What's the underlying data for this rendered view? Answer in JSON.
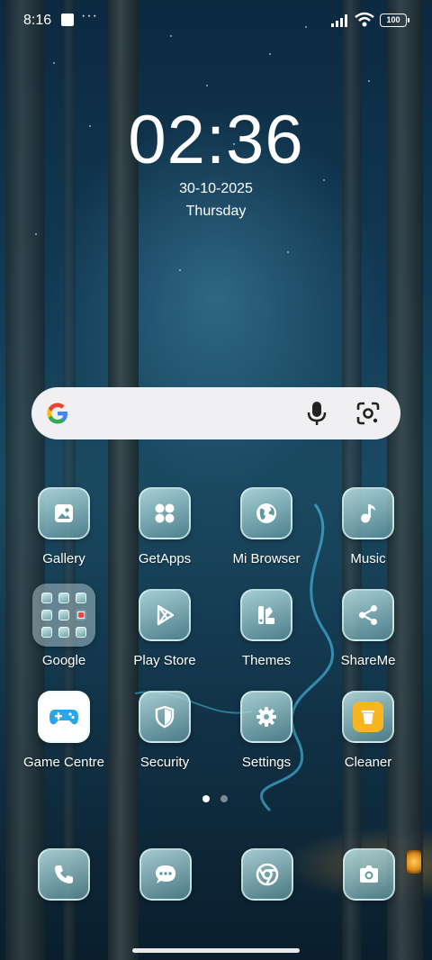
{
  "status_bar": {
    "time": "8:16",
    "more": "···",
    "battery": "100"
  },
  "lock_clock": {
    "time": "02:36",
    "date": "30-10-2025",
    "weekday": "Thursday"
  },
  "search_bar": {
    "icons": [
      "google-logo",
      "mic-icon",
      "lens-icon"
    ]
  },
  "apps": [
    {
      "label": "Gallery",
      "icon": "gallery-icon"
    },
    {
      "label": "GetApps",
      "icon": "getapps-icon"
    },
    {
      "label": "Mi Browser",
      "icon": "globe-icon"
    },
    {
      "label": "Music",
      "icon": "music-note-icon"
    },
    {
      "label": "Google",
      "icon": "folder-icon"
    },
    {
      "label": "Play Store",
      "icon": "play-store-icon"
    },
    {
      "label": "Themes",
      "icon": "themes-icon"
    },
    {
      "label": "ShareMe",
      "icon": "share-icon"
    },
    {
      "label": "Game Centre",
      "icon": "gamepad-icon"
    },
    {
      "label": "Security",
      "icon": "shield-icon"
    },
    {
      "label": "Settings",
      "icon": "gear-icon"
    },
    {
      "label": "Cleaner",
      "icon": "trash-icon"
    }
  ],
  "dock": [
    {
      "name": "phone",
      "icon": "phone-icon"
    },
    {
      "name": "messaging",
      "icon": "chat-icon"
    },
    {
      "name": "chrome",
      "icon": "chrome-icon"
    },
    {
      "name": "camera",
      "icon": "camera-icon"
    }
  ],
  "pager": {
    "pages": 2,
    "current": 1
  },
  "colors": {
    "accent": "#f7b520",
    "search_bg": "#f0f0f2"
  }
}
